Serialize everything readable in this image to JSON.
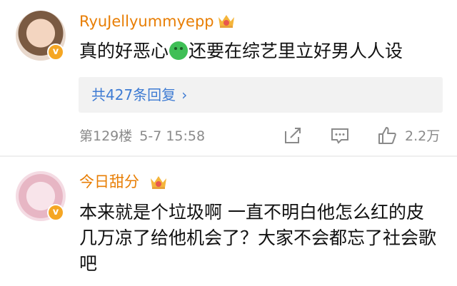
{
  "comments": [
    {
      "username": "RyuJellyummyepp",
      "badge_letter": "v",
      "text_before_emoji": "真的好恶心",
      "emoji": "nauseated-face",
      "text_after_emoji": "还要在综艺里立好男人人设",
      "replies_label": "共427条回复",
      "replies_chevron": "›",
      "floor": "第129楼",
      "date": "5-7 15:58",
      "likes": "2.2万"
    },
    {
      "username": "今日甜分",
      "badge_letter": "v",
      "text": "本来就是个垃圾啊 一直不明白他怎么红的皮几万凉了给他机会了？大家不会都忘了社会歌吧"
    }
  ],
  "colors": {
    "username": "#e87e04",
    "link": "#3e7bd3",
    "meta": "#8a8a8a",
    "badge": "#f5a623"
  }
}
